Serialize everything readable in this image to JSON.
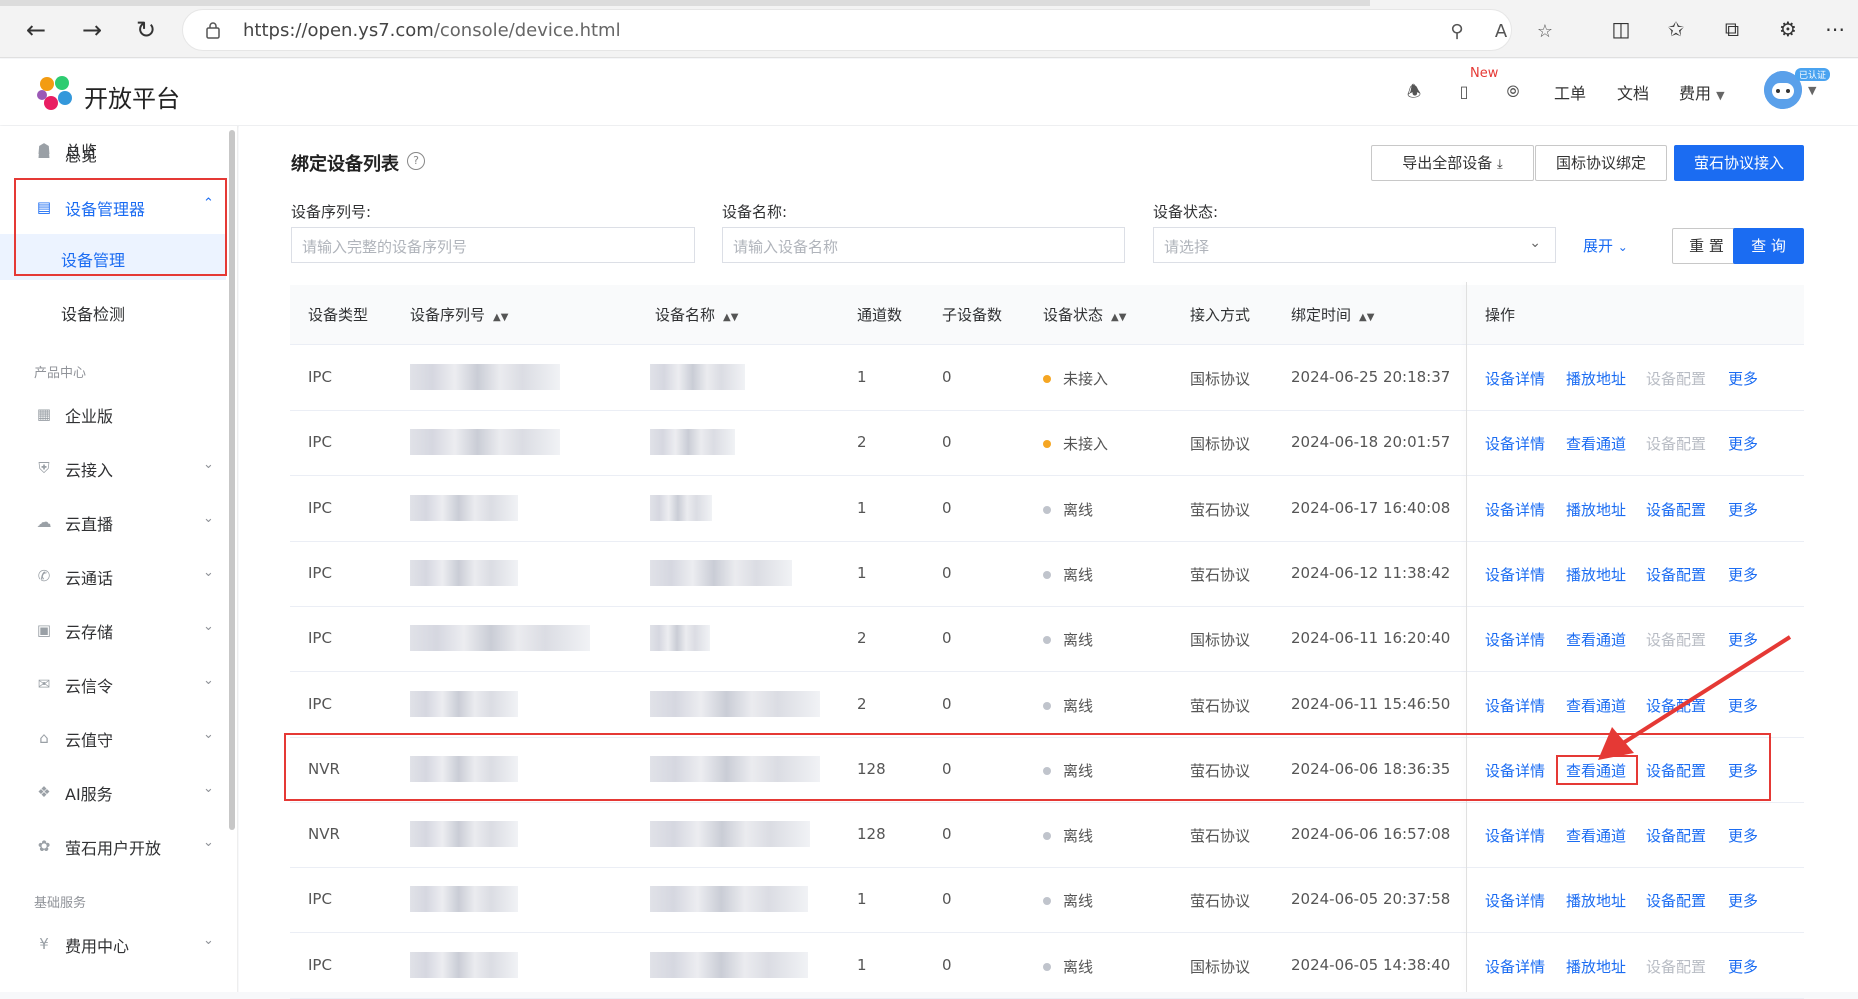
{
  "browser": {
    "url_host": "https://open.ys7.com",
    "url_path": "/console/device.html"
  },
  "header": {
    "brand": "开放平台",
    "new_badge": "New",
    "links": [
      "工单",
      "文档",
      "费用"
    ],
    "verified_badge": "已认证"
  },
  "sidebar": {
    "overview": "总览",
    "device_manager": "设备管理器",
    "device_management": "设备管理",
    "device_detection": "设备检测",
    "group_products": "产品中心",
    "enterprise": "企业版",
    "cloud_access": "云接入",
    "cloud_live": "云直播",
    "cloud_call": "云通话",
    "cloud_storage": "云存储",
    "cloud_signal": "云信令",
    "cloud_guard": "云值守",
    "ai_service": "AI服务",
    "ys_user_open": "萤石用户开放",
    "group_basic": "基础服务",
    "billing": "费用中心"
  },
  "page": {
    "title": "绑定设备列表",
    "export_btn": "导出全部设备",
    "gb_bind_btn": "国标协议绑定",
    "ys_access_btn": "萤石协议接入",
    "filter_serial_label": "设备序列号:",
    "filter_serial_placeholder": "请输入完整的设备序列号",
    "filter_name_label": "设备名称:",
    "filter_name_placeholder": "请输入设备名称",
    "filter_status_label": "设备状态:",
    "filter_status_placeholder": "请选择",
    "expand": "展开",
    "reset": "重 置",
    "query": "查 询"
  },
  "table": {
    "headers": [
      "设备类型",
      "设备序列号",
      "设备名称",
      "通道数",
      "子设备数",
      "设备状态",
      "接入方式",
      "绑定时间",
      "操作"
    ],
    "rows": [
      {
        "type": "IPC",
        "channels": "1",
        "subs": "0",
        "status": "未接入",
        "status_color": "#f5a623",
        "access": "国标协议",
        "time": "2024-06-25 20:18:37",
        "a2": "播放地址",
        "a3_disabled": true
      },
      {
        "type": "IPC",
        "channels": "2",
        "subs": "0",
        "status": "未接入",
        "status_color": "#f5a623",
        "access": "国标协议",
        "time": "2024-06-18 20:01:57",
        "a2": "查看通道",
        "a3_disabled": true
      },
      {
        "type": "IPC",
        "channels": "1",
        "subs": "0",
        "status": "离线",
        "status_color": "#c0c4cc",
        "access": "萤石协议",
        "time": "2024-06-17 16:40:08",
        "a2": "播放地址",
        "a3_disabled": false
      },
      {
        "type": "IPC",
        "channels": "1",
        "subs": "0",
        "status": "离线",
        "status_color": "#c0c4cc",
        "access": "萤石协议",
        "time": "2024-06-12 11:38:42",
        "a2": "播放地址",
        "a3_disabled": false
      },
      {
        "type": "IPC",
        "channels": "2",
        "subs": "0",
        "status": "离线",
        "status_color": "#c0c4cc",
        "access": "国标协议",
        "time": "2024-06-11 16:20:40",
        "a2": "查看通道",
        "a3_disabled": true
      },
      {
        "type": "IPC",
        "channels": "2",
        "subs": "0",
        "status": "离线",
        "status_color": "#c0c4cc",
        "access": "萤石协议",
        "time": "2024-06-11 15:46:50",
        "a2": "查看通道",
        "a3_disabled": false
      },
      {
        "type": "NVR",
        "channels": "128",
        "subs": "0",
        "status": "离线",
        "status_color": "#c0c4cc",
        "access": "萤石协议",
        "time": "2024-06-06 18:36:35",
        "a2": "查看通道",
        "a3_disabled": false
      },
      {
        "type": "NVR",
        "channels": "128",
        "subs": "0",
        "status": "离线",
        "status_color": "#c0c4cc",
        "access": "萤石协议",
        "time": "2024-06-06 16:57:08",
        "a2": "查看通道",
        "a3_disabled": false
      },
      {
        "type": "IPC",
        "channels": "1",
        "subs": "0",
        "status": "离线",
        "status_color": "#c0c4cc",
        "access": "萤石协议",
        "time": "2024-06-05 20:37:58",
        "a2": "播放地址",
        "a3_disabled": false
      },
      {
        "type": "IPC",
        "channels": "1",
        "subs": "0",
        "status": "离线",
        "status_color": "#c0c4cc",
        "access": "国标协议",
        "time": "2024-06-05 14:38:40",
        "a2": "播放地址",
        "a3_disabled": true
      }
    ],
    "action_detail": "设备详情",
    "action_config": "设备配置",
    "action_more": "更多"
  },
  "colors": {
    "accent": "#1b6cf2",
    "highlight": "#e53935"
  }
}
